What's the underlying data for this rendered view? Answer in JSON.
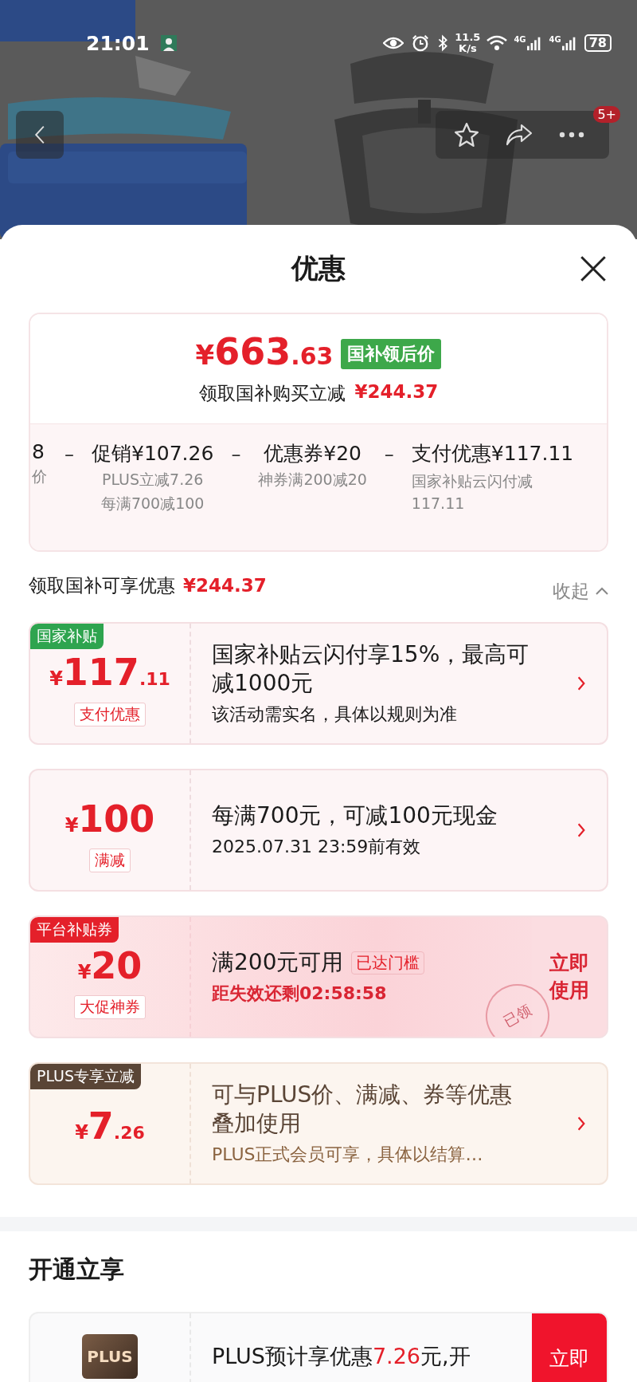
{
  "status_bar": {
    "time": "21:01",
    "speed_value": "11.5",
    "speed_unit": "K/s",
    "network_labels": [
      "4G",
      "4G"
    ],
    "battery": "78"
  },
  "nav": {
    "badge": "5+"
  },
  "sheet": {
    "title": "优惠"
  },
  "summary": {
    "currency": "¥",
    "price_int": "663",
    "price_dec": ".63",
    "tag": "国补领后价",
    "subtitle": "领取国补购买立减",
    "subtitle_amount": "¥244.37",
    "breakdown": [
      {
        "amount": "8",
        "notes": [
          "价"
        ]
      },
      {
        "operator": "–",
        "label": "促销",
        "amount": "¥107.26",
        "notes": [
          "PLUS立减7.26",
          "每满700减100"
        ]
      },
      {
        "operator": "–",
        "label": "优惠券",
        "amount": "¥20",
        "notes": [
          "神券满200减20"
        ]
      },
      {
        "operator": "–",
        "label": "支付优惠",
        "amount": "¥117.11",
        "notes": [
          "国家补贴云闪付减117.11"
        ]
      }
    ]
  },
  "discount_header": {
    "label": "领取国补可享优惠",
    "amount": "¥244.37",
    "toggle": "收起"
  },
  "offers": [
    {
      "kind": "subsidy",
      "tag": "国家补贴",
      "currency": "¥",
      "amount_int": "117",
      "amount_dec": ".11",
      "label": "支付优惠",
      "title": "国家补贴云闪付享15%，最高可减1000元",
      "subtitle": "该活动需实名，具体以规则为准"
    },
    {
      "kind": "plain",
      "currency": "¥",
      "amount_int": "100",
      "label": "满减",
      "title": "每满700元，可减100元现金",
      "subtitle": "2025.07.31 23:59前有效"
    },
    {
      "kind": "coupon",
      "tag": "平台补贴券",
      "currency": "¥",
      "amount_int": "20",
      "label": "大促神券",
      "title": "满200元可用",
      "badge": "已达门槛",
      "subtitle": "距失效还剩02:58:58",
      "action": "立即使用",
      "stamp": "已领"
    },
    {
      "kind": "plus",
      "tag": "PLUS专享立减",
      "currency": "¥",
      "amount_int": "7",
      "amount_dec": ".26",
      "title": "可与PLUS价、满减、券等优惠叠加使用",
      "subtitle": "PLUS正式会员可享，具体以结算…"
    }
  ],
  "open_plus": {
    "title": "开通立享",
    "logo": "PLUS",
    "text": [
      {
        "text": "PLUS预计享优惠",
        "highlight": false
      },
      {
        "text": "7.26",
        "highlight": true
      },
      {
        "text": "元,开",
        "highlight": false
      }
    ],
    "action": "立即"
  }
}
